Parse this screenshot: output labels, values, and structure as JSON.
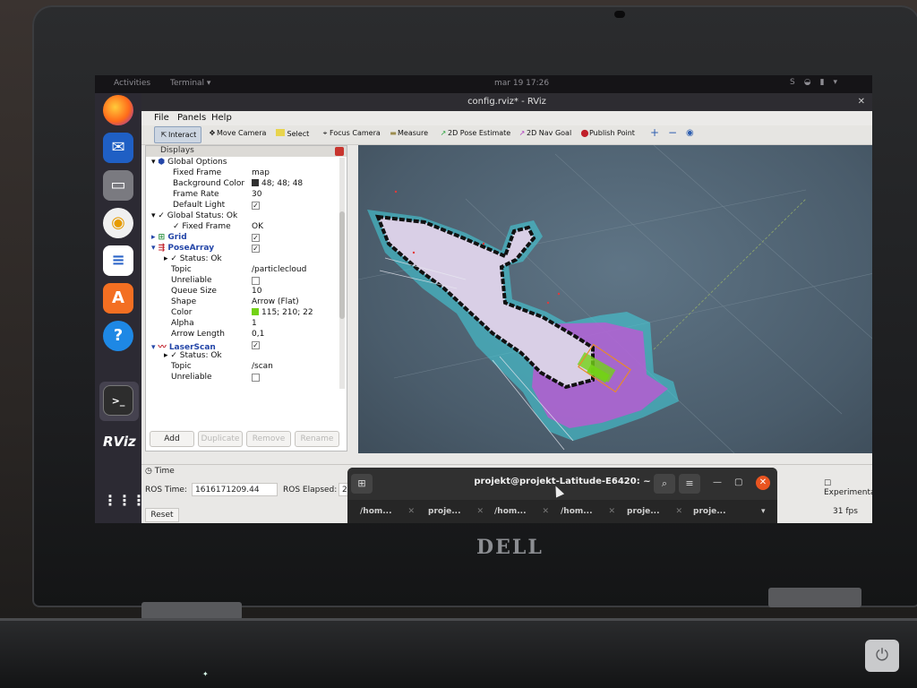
{
  "topbar": {
    "activities": "Activities",
    "app_menu": "Terminal ▾",
    "clock": "mar 19  17:26",
    "tray_icons": [
      "skype-icon",
      "wifi-icon",
      "battery-icon",
      "menu-icon"
    ]
  },
  "dock": {
    "apps": [
      "firefox-icon",
      "thunderbird-icon",
      "files-icon",
      "rhythmbox-icon",
      "writer-icon",
      "software-icon",
      "help-icon",
      "terminal-icon",
      "rviz-icon",
      "app-grid-icon"
    ],
    "rviz_label": "RViz"
  },
  "window": {
    "title": "config.rviz* - RViz",
    "menu": [
      "File",
      "Panels",
      "Help"
    ]
  },
  "toolbar": {
    "tools": [
      "Interact",
      "Move Camera",
      "Select",
      "Focus Camera",
      "Measure",
      "2D Pose Estimate",
      "2D Nav Goal",
      "Publish Point"
    ],
    "plus": "+",
    "minus": "−",
    "eye": "◉"
  },
  "displays": {
    "header": "Displays",
    "rows": [
      {
        "key": "Global Options",
        "value": ""
      },
      {
        "key": "Fixed Frame",
        "value": "map"
      },
      {
        "key": "Background Color",
        "value": "48; 48; 48"
      },
      {
        "key": "Frame Rate",
        "value": "30"
      },
      {
        "key": "Default Light",
        "value": "✓"
      },
      {
        "key": "Global Status: Ok",
        "value": ""
      },
      {
        "key": "Fixed Frame",
        "value": "OK"
      },
      {
        "key": "Grid",
        "value": "✓"
      },
      {
        "key": "PoseArray",
        "value": "✓"
      },
      {
        "key": "Status: Ok",
        "value": ""
      },
      {
        "key": "Topic",
        "value": "/particlecloud"
      },
      {
        "key": "Unreliable",
        "value": ""
      },
      {
        "key": "Queue Size",
        "value": "10"
      },
      {
        "key": "Shape",
        "value": "Arrow (Flat)"
      },
      {
        "key": "Color",
        "value": "115; 210; 22"
      },
      {
        "key": "Alpha",
        "value": "1"
      },
      {
        "key": "Arrow Length",
        "value": "0,1"
      },
      {
        "key": "LaserScan",
        "value": "✓"
      },
      {
        "key": "Status: Ok",
        "value": ""
      },
      {
        "key": "Topic",
        "value": "/scan"
      },
      {
        "key": "Unreliable",
        "value": ""
      }
    ],
    "buttons": [
      "Add",
      "Duplicate",
      "Remove",
      "Rename"
    ]
  },
  "time": {
    "header": "Time",
    "ros_time_label": "ROS Time:",
    "ros_time_value": "1616171209.44",
    "ros_elapsed_label": "ROS Elapsed:",
    "ros_elapsed_value": "2",
    "reset": "Reset",
    "experimental": "Experimental",
    "fps": "31 fps"
  },
  "terminal": {
    "title": "projekt@projekt-Latitude-E6420: ~",
    "tabs": [
      "/hom...",
      "proje...",
      "/hom...",
      "/hom...",
      "proje...",
      "proje..."
    ]
  },
  "laptop": {
    "brand": "DELL"
  },
  "colors": {
    "background_swatch": "#303030",
    "pose_color_swatch": "#73d216",
    "laser_cyan": "#42d3e0",
    "laser_magenta": "#c653d6",
    "map_free": "#d9cfe6",
    "map_wall": "#111111"
  }
}
